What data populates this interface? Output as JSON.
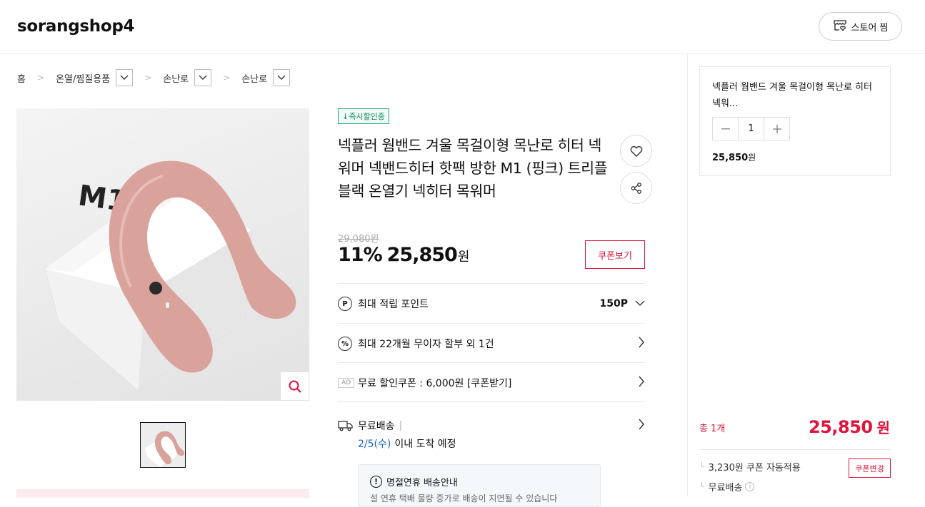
{
  "header": {
    "store_name": "sorangshop4",
    "zzim_label": "스토어 찜"
  },
  "breadcrumb": {
    "home": "홈",
    "levels": [
      "온열/찜질용품",
      "손난로",
      "손난로"
    ]
  },
  "product": {
    "badge": "↓즉시할인중",
    "title": "넥플러 웜밴드 겨울 목걸이형 목난로 히터 넥워머 넥밴드히터 핫팩 방한 M1 (핑크) 트리플블랙 온열기 넥히터 목워머",
    "original_price": "29,080원",
    "discount_rate": "11%",
    "sale_price": "25,850",
    "sale_unit": "원",
    "coupon_button": "쿠폰보기",
    "image_alt": "pink neck warmer",
    "thumb_count": 1
  },
  "benefits": {
    "points_label": "최대 적립 포인트",
    "points_value": "150P",
    "installment_label": "최대 22개월 무이자 할부 외 1건",
    "ad_tag": "AD",
    "free_coupon_label": "무료 할인쿠폰 : 6,000원 [쿠폰받기]",
    "shipping_label": "무료배송",
    "shipping_divider": "|",
    "arrival_date": "2/5(수)",
    "arrival_text": "이내 도착 예정",
    "notice_title": "명절연휴 배송안내",
    "notice_sub": "설 연휴 택배 물량 증가로 배송이 지연될 수 있습니다"
  },
  "side": {
    "option_name": "넥플러 웜밴드 겨울 목걸이형 목난로 히터 넥워...",
    "quantity": "1",
    "option_price": "25,850",
    "option_unit": "원",
    "total_label": "총 1개",
    "total_price": "25,850",
    "total_unit": "원",
    "coupon_applied": "3,230원 쿠폰 자동적용",
    "coupon_change": "쿠폰변경",
    "free_shipping": "무료배송"
  },
  "colors": {
    "accent_red": "#e0143c",
    "badge_green": "#19a873",
    "date_blue": "#1a64c8",
    "product_pink": "#d9a39c"
  }
}
